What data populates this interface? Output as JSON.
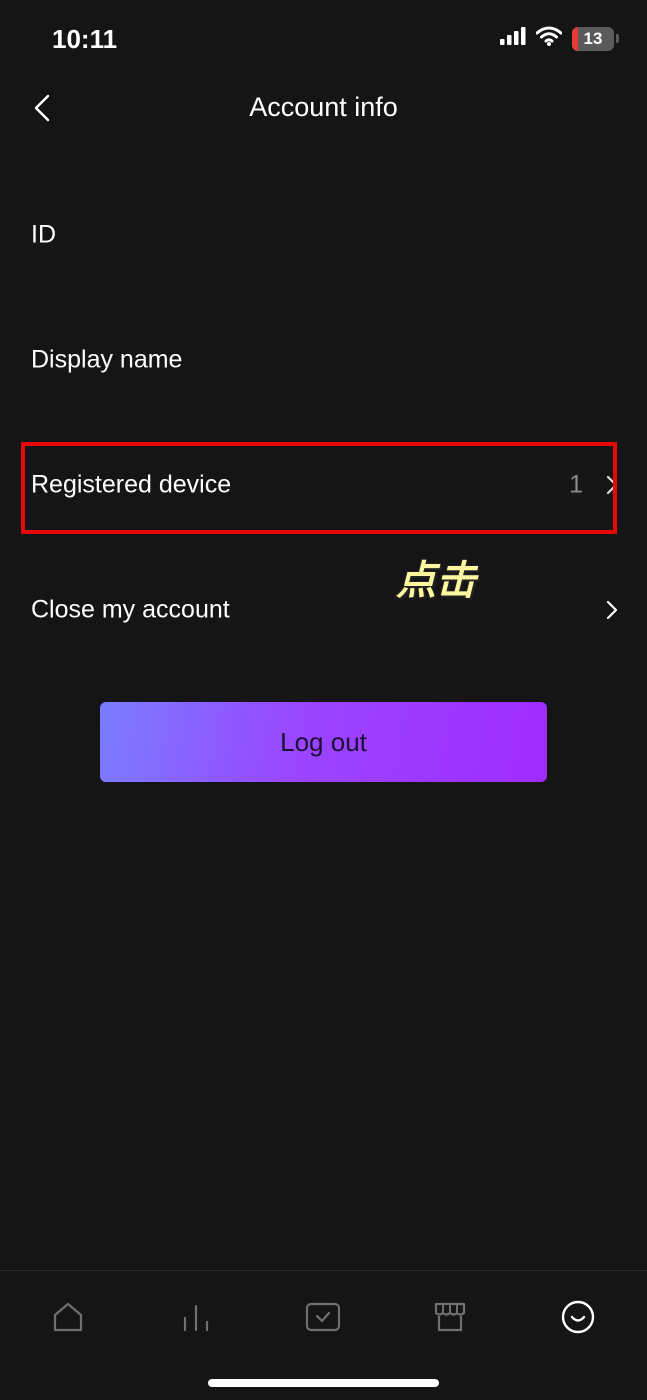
{
  "status_bar": {
    "time": "10:11",
    "battery_level": "13",
    "icons": [
      "signal-icon",
      "wifi-icon",
      "battery-icon"
    ]
  },
  "header": {
    "title": "Account info",
    "back_icon": "chevron-left-icon"
  },
  "rows": [
    {
      "label": "ID",
      "value": "",
      "chevron": false
    },
    {
      "label": "Display name",
      "value": "",
      "chevron": false
    },
    {
      "label": "Registered device",
      "value": "1",
      "chevron": true
    },
    {
      "label": "Close my account",
      "value": "",
      "chevron": true
    }
  ],
  "annotation": {
    "text": "点击",
    "highlight_color": "#e40808"
  },
  "logout": {
    "label": "Log out",
    "gradient_start": "#7a7dff",
    "gradient_end": "#a02cff"
  },
  "tab_bar": {
    "tabs": [
      {
        "icon": "home-icon",
        "active": false
      },
      {
        "icon": "stats-icon",
        "active": false
      },
      {
        "icon": "checkbox-icon",
        "active": false
      },
      {
        "icon": "store-icon",
        "active": false
      },
      {
        "icon": "smiley-icon",
        "active": true
      }
    ]
  },
  "colors": {
    "background": "#151515",
    "text": "#ffffff",
    "muted": "#8a8a8a"
  }
}
